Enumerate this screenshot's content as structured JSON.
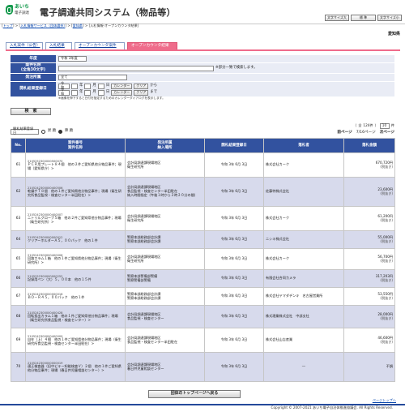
{
  "header": {
    "logo_line1": "あいち",
    "logo_line2": "電子調達",
    "title": "電子調達共同システム（物品等）",
    "buttons": [
      "文字サイズ大",
      "標 準",
      "文字サイズ小"
    ]
  },
  "breadcrumb": {
    "top": "トップ",
    "sep": ">",
    "items": [
      "入札情報サービス（団体選択）",
      "愛知県",
      "入札情報-オープンカウンタ結果"
    ]
  },
  "organization": "愛知県",
  "tabs": [
    "入札案件（公告）",
    "入札結果",
    "オープンカウンタ案件",
    "オープンカウンタ結果"
  ],
  "search": {
    "fiscal_year_label": "年度",
    "fiscal_year_value": "令和 3年度",
    "case_name_label": "案件名称\n(全角30文字)",
    "case_name_value": "",
    "case_note": "※部分一致で検索します。",
    "orderer_label": "発注所属",
    "orderer_value": "全て",
    "date_label": "開札結果登録日",
    "date_from": [
      "令和",
      "",
      "年",
      "",
      "月",
      "",
      "日"
    ],
    "date_to": [
      "令和",
      "",
      "年",
      "",
      "月",
      "",
      "日"
    ],
    "calendar": "カレンダー",
    "clear": "クリア",
    "from_text": "から",
    "to_text": "まで",
    "date_note": "※画像を押下すると日付を指定するためのカレンダーダイアログを表示します。",
    "search_button": "検　索"
  },
  "list": {
    "sort_label": "開札結果登録日",
    "sort_asc": "昇 順",
    "sort_desc": "降 順",
    "total_label": "全",
    "total_count": "124件",
    "page_size": "10",
    "page_label": "件",
    "prev": "前ページ",
    "page": "7/16ページ",
    "next": "次ページ",
    "columns": [
      "No.",
      "案件番号\n案件名称",
      "発注所属\n納入場所",
      "開札結果登録日",
      "落札者",
      "落札金額"
    ]
  },
  "rows": [
    {
      "no": "61",
      "number": "2105252300000500070",
      "name": "ＰＣＲ用プレート８４個　他の２件ご愛知県他分物品事件；現場（愛知県庁）>",
      "orderer": "会計局調達課現場地区\n衛生研究所",
      "date": "令和 3年  6月  3日",
      "winner": "株式会社カーク",
      "amount": "670,720円",
      "tax": "(税抜き)"
    },
    {
      "no": "62",
      "number": "2105242300000400506",
      "name": "乾燥ゲＴ８個　他の１件ご愛知県他分物品事件；現場（衛生研究所食品監視・検査センター半田駐在）>",
      "orderer": "会計局調達課現場地区\n食品監視・検査センター半田駐在\n納入時間指定（午後１時から３時３０分の間）",
      "date": "令和 3年  6月  3日",
      "winner": "佐藤特株式会社",
      "amount": "23,600円",
      "tax": "(税抜き)"
    },
    {
      "no": "63",
      "number": "2105242300000400007",
      "name": "ニトリルグローブ５箱　他の２件ご愛知県他分物品事件；現場（衛生研究所）>",
      "orderer": "会計局調達課現場地区\n衛生研究所",
      "date": "令和 3年  6月  3日",
      "winner": "株式会社カーク",
      "amount": "61,200円",
      "tax": "(税抜き)"
    },
    {
      "no": "64",
      "number": "2105242300000000012",
      "name": "クリアーホルダーＡ５，００パック　他の１件",
      "orderer": "警察本部総務部会計課\n警察本部総務部会計課",
      "date": "令和 3年  6月  3日",
      "winner": "ニシキ株式会社",
      "amount": "55,000円",
      "tax": "(税抜き)"
    },
    {
      "no": "65",
      "number": "2105242300000400006",
      "name": "回路カラム１箱　他の１件ご愛知県他分物品事件；現場（衛生研究所）>",
      "orderer": "会計局調達課現場地区\n衛生研究所",
      "date": "令和 3年  6月  3日",
      "winner": "株式会社カーク",
      "amount": "56,700円",
      "tax": "(税抜き)"
    },
    {
      "no": "66",
      "number": "2105252300000000252",
      "name": "記録用ペン（大）５，００本　他の１５件",
      "orderer": "警察本部警備部警備\n警察警備部警備",
      "date": "令和 3年  6月  3日",
      "winner": "有限会社合同カメラ",
      "amount": "317,203円",
      "tax": "(税抜き)"
    },
    {
      "no": "67",
      "number": "2105242300000000016",
      "name": "ＢＯ－Ｒ４５，００パック　他の１件",
      "orderer": "警察本部総務部会計課\n警察本部総務部会計課",
      "date": "令和 3年  6月  3日",
      "winner": "株式会社ヤマダデンキ　名古屋営業所",
      "amount": "53,550円",
      "tax": "(税抜き)"
    },
    {
      "no": "68",
      "number": "2105242300000400428",
      "name": "回転投出カラム１箱　他の１件ご愛知県他分物品事件；現場（衛生研究所食品監視・検査センター）>",
      "orderer": "会計局調達課現場地区\n食品監視・検査センター",
      "date": "令和 3年  6月  3日",
      "winner": "株式理業株式会社　中部支社",
      "amount": "28,000円",
      "tax": "(税抜き)"
    },
    {
      "no": "69",
      "number": "2105242300000400009",
      "name": "自在（上）４個　他の１件ご愛知県他分物品事件；現場（衛生研究所食品監視・検査センター半田駐在）>",
      "orderer": "会計局調達課現場地区\n食品監視・検査センター半田駐在",
      "date": "令和 3年  6月  3日",
      "winner": "株式会社山吉産業",
      "amount": "46,600円",
      "tax": "(税抜き)"
    },
    {
      "no": "70",
      "number": "2105242300000000019",
      "name": "適正検査器（旧中ビキー知能検査Ｖ）２個　他の１件ご愛知県他分物品事件；現場（春日井児童相談センター）>",
      "orderer": "会計局調達課現場地区\n春日井児童相談センター",
      "date": "令和 3年  6月  3日",
      "winner": "―",
      "amount": "不調",
      "tax": ""
    }
  ],
  "footer": {
    "back_button": "団体のトップページへ戻る",
    "page_top": "ページトップへ",
    "copyright": "Copyright © 2007-2021 あいち電子自治体推進協議会. All Rights Reserved."
  }
}
